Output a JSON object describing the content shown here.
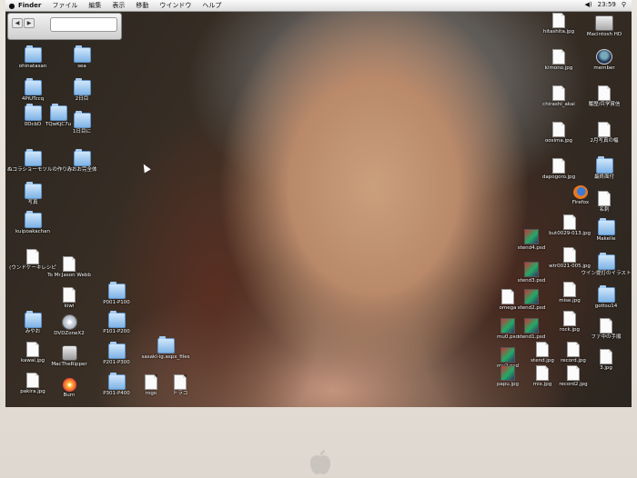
{
  "menubar": {
    "items": [
      "Finder",
      "ファイル",
      "編集",
      "表示",
      "移動",
      "ウインドウ",
      "ヘルプ"
    ],
    "clock": "23:59"
  },
  "finder_toolbar": {
    "apple_glyph": ""
  },
  "desktop": {
    "left_icons": [
      {
        "label": "ohinatasan",
        "kind": "folder"
      },
      {
        "label": "sea",
        "kind": "folder"
      },
      {
        "label": "4PiUTccq",
        "kind": "folder"
      },
      {
        "label": "2日目",
        "kind": "folder"
      },
      {
        "label": "0DcbD",
        "kind": "folder"
      },
      {
        "label": "TQwKjC7u",
        "kind": "folder"
      },
      {
        "label": "1日目に",
        "kind": "folder"
      },
      {
        "label": "ぬコラショーモツルの作り方",
        "kind": "folder"
      },
      {
        "label": "みおお完全体",
        "kind": "folder"
      },
      {
        "label": "写真",
        "kind": "folder"
      },
      {
        "label": "kuipoakachan",
        "kind": "folder"
      },
      {
        "label": "(ウンドケーキレシピ",
        "kind": "doc"
      },
      {
        "label": "To Mr.Jason Webb",
        "kind": "doc"
      },
      {
        "label": "kiwi",
        "kind": "doc"
      },
      {
        "label": "P001-P100",
        "kind": "folder"
      },
      {
        "label": "みやお",
        "kind": "folder"
      },
      {
        "label": "DVDZoneX2",
        "kind": "disc"
      },
      {
        "label": "P101-P200",
        "kind": "folder"
      },
      {
        "label": "kawai.jpg",
        "kind": "doc"
      },
      {
        "label": "MacTheRipper",
        "kind": "app"
      },
      {
        "label": "P201-P300",
        "kind": "folder"
      },
      {
        "label": "sasaki-ig.aspx_files",
        "kind": "folder"
      },
      {
        "label": "pakira.jpg",
        "kind": "doc"
      },
      {
        "label": "Burn",
        "kind": "burn"
      },
      {
        "label": "P301-P400",
        "kind": "folder"
      },
      {
        "label": "rogo",
        "kind": "doc"
      },
      {
        "label": "トラコ",
        "kind": "doc"
      }
    ],
    "right_icons": [
      {
        "label": "hitashita.jpg",
        "kind": "doc"
      },
      {
        "label": "Macintosh HD",
        "kind": "hd"
      },
      {
        "label": "kimono.jpg",
        "kind": "doc"
      },
      {
        "label": "member",
        "kind": "usr"
      },
      {
        "label": "chirashi_akai",
        "kind": "doc"
      },
      {
        "label": "履歴/兵学賞信",
        "kind": "doc"
      },
      {
        "label": "oosima.jpg",
        "kind": "doc"
      },
      {
        "label": "2月写真の幅",
        "kind": "doc"
      },
      {
        "label": "dapogoro.jpg",
        "kind": "doc"
      },
      {
        "label": "最終面付",
        "kind": "folder"
      },
      {
        "label": "Firefox",
        "kind": "ff"
      },
      {
        "label": "名刺",
        "kind": "doc"
      },
      {
        "label": "stend4.psd",
        "kind": "psd"
      },
      {
        "label": "but0029-013.jpg",
        "kind": "doc"
      },
      {
        "label": "Makelle",
        "kind": "folder"
      },
      {
        "label": "stend3.psd",
        "kind": "psd"
      },
      {
        "label": "wtr0021-005.jpg",
        "kind": "doc"
      },
      {
        "label": "ウイン提灯のイラスト",
        "kind": "folder"
      },
      {
        "label": "omega",
        "kind": "doc"
      },
      {
        "label": "stend2.psd",
        "kind": "psd"
      },
      {
        "label": "mise.jpg",
        "kind": "doc"
      },
      {
        "label": "gottsu14",
        "kind": "folder"
      },
      {
        "label": "mu0.psd",
        "kind": "psd"
      },
      {
        "label": "stend1.psd",
        "kind": "psd"
      },
      {
        "label": "rock.jpg",
        "kind": "doc"
      },
      {
        "label": "ファ中の手順",
        "kind": "doc"
      },
      {
        "label": "mu2.psd",
        "kind": "psd"
      },
      {
        "label": "stend.jpg",
        "kind": "doc"
      },
      {
        "label": "record.jpg",
        "kind": "doc"
      },
      {
        "label": "3.jpg",
        "kind": "doc"
      },
      {
        "label": "papu.jpg",
        "kind": "psd"
      },
      {
        "label": "mix.jpg",
        "kind": "doc"
      },
      {
        "label": "record2.jpg",
        "kind": "doc"
      }
    ]
  }
}
